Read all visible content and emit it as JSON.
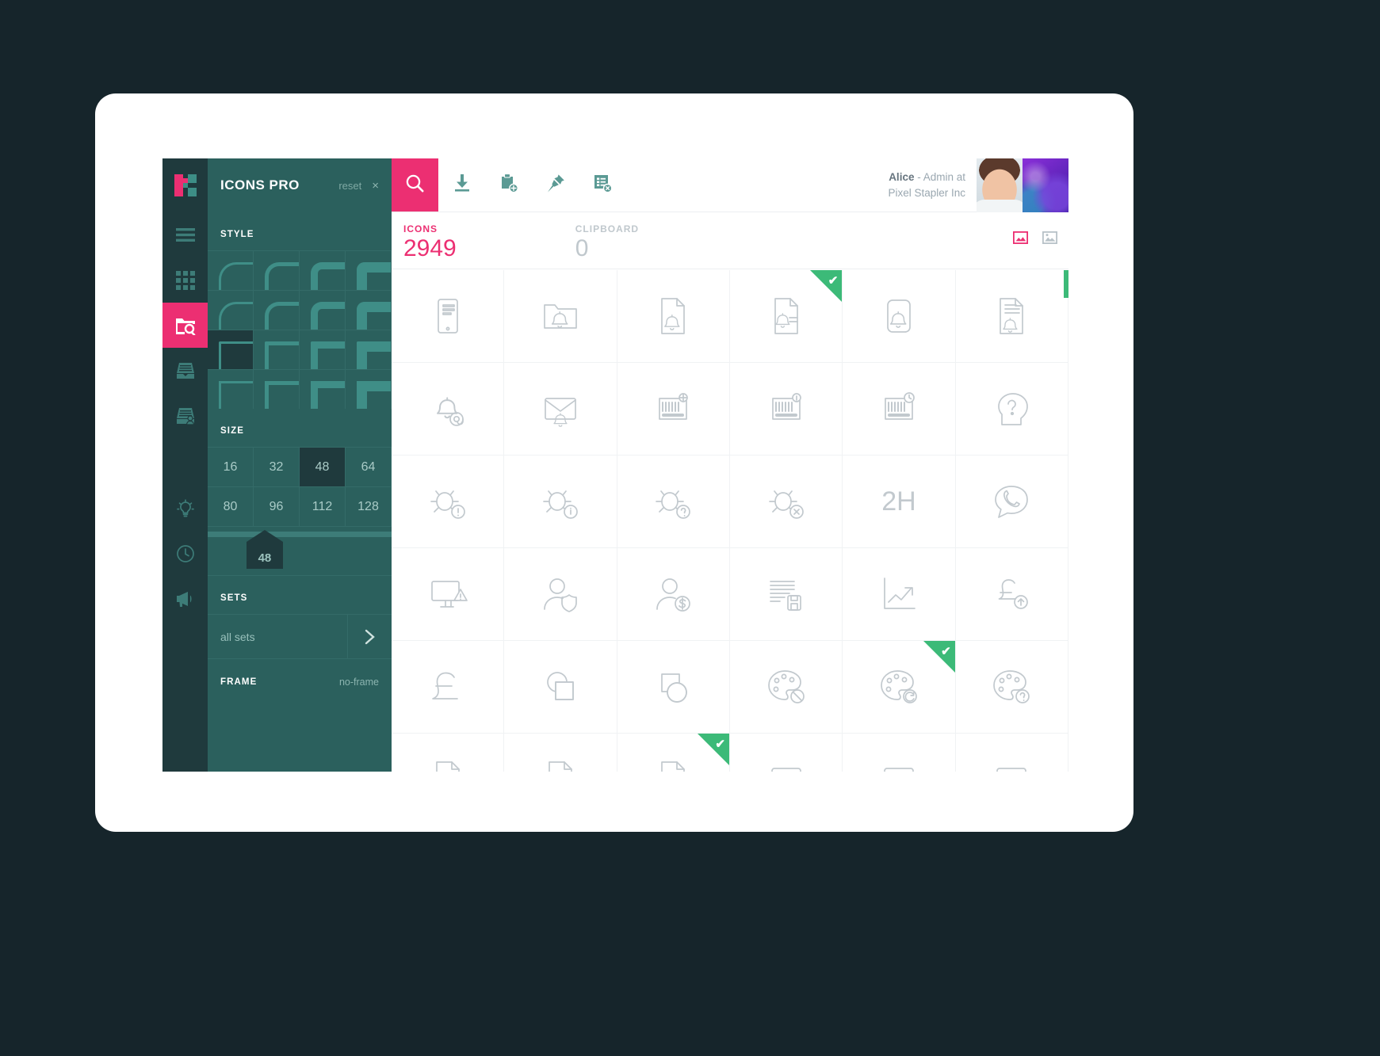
{
  "app": {
    "brand": "ICONS PRO",
    "reset_label": "reset",
    "close_label": "×"
  },
  "rail": {
    "items": [
      {
        "name": "logo",
        "icon": "logo-icon",
        "active": false
      },
      {
        "name": "menu",
        "icon": "hamburger-menu-icon",
        "active": false
      },
      {
        "name": "all-icons",
        "icon": "grid-dots-icon",
        "active": false
      },
      {
        "name": "browse-sets",
        "icon": "folder-search-icon",
        "active": true
      },
      {
        "name": "archive",
        "icon": "inbox-tray-icon",
        "active": false
      },
      {
        "name": "my-sets",
        "icon": "inbox-user-icon",
        "active": false
      },
      {
        "name": "ideas",
        "icon": "lightbulb-icon",
        "active": false
      },
      {
        "name": "history",
        "icon": "clock-icon",
        "active": false
      },
      {
        "name": "news",
        "icon": "megaphone-icon",
        "active": false
      }
    ]
  },
  "panel": {
    "style": {
      "label": "STYLE",
      "selected_index": 8,
      "cells": [
        {
          "radius": 22,
          "weight": 3
        },
        {
          "radius": 18,
          "weight": 5
        },
        {
          "radius": 14,
          "weight": 9
        },
        {
          "radius": 10,
          "weight": 13
        },
        {
          "radius": 22,
          "weight": 3
        },
        {
          "radius": 18,
          "weight": 5
        },
        {
          "radius": 14,
          "weight": 9
        },
        {
          "radius": 10,
          "weight": 13
        },
        {
          "radius": 2,
          "weight": 3
        },
        {
          "radius": 2,
          "weight": 5
        },
        {
          "radius": 2,
          "weight": 9
        },
        {
          "radius": 2,
          "weight": 13
        },
        {
          "radius": 0,
          "weight": 3
        },
        {
          "radius": 0,
          "weight": 5
        },
        {
          "radius": 0,
          "weight": 9
        },
        {
          "radius": 0,
          "weight": 13
        }
      ]
    },
    "size": {
      "label": "SIZE",
      "options": [
        "16",
        "32",
        "48",
        "64",
        "80",
        "96",
        "112",
        "128"
      ],
      "selected": "48",
      "slider_value": "48",
      "slider_percent": 31
    },
    "sets": {
      "label": "SETS",
      "value": "all sets",
      "chevron_icon": "chevron-right-icon"
    },
    "frame": {
      "label": "FRAME",
      "value": "no-frame"
    }
  },
  "toolbar": {
    "buttons": [
      {
        "name": "search-button",
        "icon": "search-icon",
        "active": true
      },
      {
        "name": "download-button",
        "icon": "download-icon",
        "active": false
      },
      {
        "name": "add-to-clipboard-button",
        "icon": "clipboard-add-icon",
        "active": false
      },
      {
        "name": "pin-button",
        "icon": "pin-icon",
        "active": false
      },
      {
        "name": "clear-list-button",
        "icon": "list-remove-icon",
        "active": false
      }
    ]
  },
  "user": {
    "name": "Alice",
    "role_prefix": " - Admin at",
    "company": "Pixel Stapler Inc"
  },
  "stats": {
    "icons": {
      "label": "ICONS",
      "count": "2949"
    },
    "clipboard": {
      "label": "CLIPBOARD",
      "count": "0"
    },
    "view_toggles": [
      {
        "name": "view-toggle-outline",
        "icon": "image-outline-icon",
        "active": true
      },
      {
        "name": "view-toggle-filled",
        "icon": "image-filled-icon",
        "active": false
      }
    ]
  },
  "colors": {
    "brand_pink": "#ec2f72",
    "panel_teal": "#2b605d",
    "rail_dark": "#1f3a3d",
    "accent_green": "#3cba78",
    "icon_gray": "#c2c9ce"
  },
  "icon_grid": {
    "selected_indexes": [
      3,
      28,
      32
    ],
    "cells": [
      {
        "name": "tablet-document-icon"
      },
      {
        "name": "folder-bell-icon"
      },
      {
        "name": "document-bell-icon"
      },
      {
        "name": "document-bell-lines-icon"
      },
      {
        "name": "rounded-square-bell-icon"
      },
      {
        "name": "document-bell-text-icon"
      },
      {
        "name": "bell-at-icon"
      },
      {
        "name": "envelope-bell-icon"
      },
      {
        "name": "barcode-settings-icon"
      },
      {
        "name": "barcode-info-icon"
      },
      {
        "name": "barcode-clock-icon"
      },
      {
        "name": "head-question-icon"
      },
      {
        "name": "bug-alert-icon"
      },
      {
        "name": "bug-info-icon"
      },
      {
        "name": "bug-question-icon"
      },
      {
        "name": "bug-remove-icon"
      },
      {
        "name": "two-hours-icon",
        "text": "2H"
      },
      {
        "name": "speech-bubble-phone-icon"
      },
      {
        "name": "monitor-warning-icon"
      },
      {
        "name": "user-shield-icon"
      },
      {
        "name": "user-dollar-icon"
      },
      {
        "name": "text-save-icon"
      },
      {
        "name": "chart-growth-icon"
      },
      {
        "name": "pound-upload-icon"
      },
      {
        "name": "pound-icon"
      },
      {
        "name": "shapes-square-icon"
      },
      {
        "name": "shapes-circle-icon"
      },
      {
        "name": "palette-block-icon"
      },
      {
        "name": "palette-refresh-icon"
      },
      {
        "name": "palette-question-icon"
      },
      {
        "name": "page-corner-icon"
      },
      {
        "name": "page-corner-2-icon"
      },
      {
        "name": "page-corner-3-icon"
      },
      {
        "name": "card-minus-icon"
      },
      {
        "name": "card-minus-2-icon"
      },
      {
        "name": "card-minus-3-icon"
      }
    ]
  }
}
